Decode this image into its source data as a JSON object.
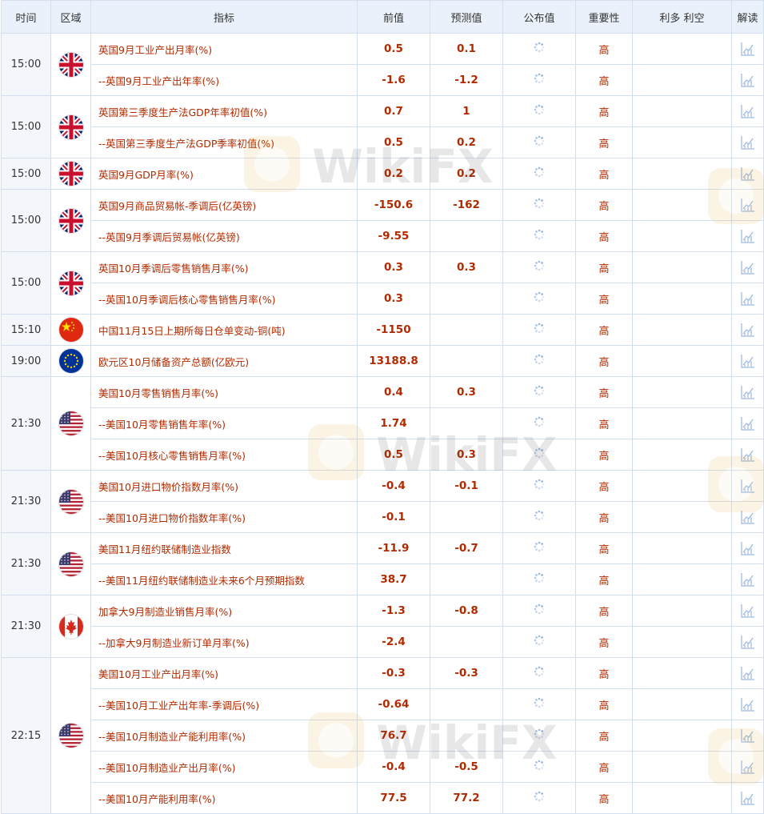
{
  "headers": [
    "时间",
    "区域",
    "指标",
    "前值",
    "预测值",
    "公布值",
    "重要性",
    "利多 利空",
    "解读"
  ],
  "groups": [
    {
      "time": "15:00",
      "flag": "uk-flag-icon",
      "rows": [
        {
          "name": "英国9月工业产出月率(%)",
          "prev": "0.5",
          "forecast": "0.1",
          "importance": "高"
        },
        {
          "name": "--英国9月工业产出年率(%)",
          "prev": "-1.6",
          "forecast": "-1.2",
          "importance": "高"
        }
      ]
    },
    {
      "time": "15:00",
      "flag": "uk-flag-icon",
      "rows": [
        {
          "name": "英国第三季度生产法GDP年率初值(%)",
          "prev": "0.7",
          "forecast": "1",
          "importance": "高"
        },
        {
          "name": "--英国第三季度生产法GDP季率初值(%)",
          "prev": "0.5",
          "forecast": "0.2",
          "importance": "高"
        }
      ]
    },
    {
      "time": "15:00",
      "flag": "uk-flag-icon",
      "rows": [
        {
          "name": "英国9月GDP月率(%)",
          "prev": "0.2",
          "forecast": "0.2",
          "importance": "高"
        }
      ]
    },
    {
      "time": "15:00",
      "flag": "uk-flag-icon",
      "rows": [
        {
          "name": "英国9月商品贸易帐-季调后(亿英镑)",
          "prev": "-150.6",
          "forecast": "-162",
          "importance": "高"
        },
        {
          "name": "--英国9月季调后贸易帐(亿英镑)",
          "prev": "-9.55",
          "forecast": "",
          "importance": "高"
        }
      ]
    },
    {
      "time": "15:00",
      "flag": "uk-flag-icon",
      "rows": [
        {
          "name": "英国10月季调后零售销售月率(%)",
          "prev": "0.3",
          "forecast": "0.3",
          "importance": "高"
        },
        {
          "name": "--英国10月季调后核心零售销售月率(%)",
          "prev": "0.3",
          "forecast": "",
          "importance": "高"
        }
      ]
    },
    {
      "time": "15:10",
      "flag": "cn-flag-icon",
      "rows": [
        {
          "name": "中国11月15日上期所每日仓单变动-铜(吨)",
          "prev": "-1150",
          "forecast": "",
          "importance": "高"
        }
      ]
    },
    {
      "time": "19:00",
      "flag": "eu-flag-icon",
      "rows": [
        {
          "name": "欧元区10月储备资产总额(亿欧元)",
          "prev": "13188.8",
          "forecast": "",
          "importance": "高"
        }
      ]
    },
    {
      "time": "21:30",
      "flag": "us-flag-icon",
      "rows": [
        {
          "name": "美国10月零售销售月率(%)",
          "prev": "0.4",
          "forecast": "0.3",
          "importance": "高"
        },
        {
          "name": "--美国10月零售销售年率(%)",
          "prev": "1.74",
          "forecast": "",
          "importance": "高"
        },
        {
          "name": "--美国10月核心零售销售月率(%)",
          "prev": "0.5",
          "forecast": "0.3",
          "importance": "高"
        }
      ]
    },
    {
      "time": "21:30",
      "flag": "us-flag-icon",
      "rows": [
        {
          "name": "美国10月进口物价指数月率(%)",
          "prev": "-0.4",
          "forecast": "-0.1",
          "importance": "高"
        },
        {
          "name": "--美国10月进口物价指数年率(%)",
          "prev": "-0.1",
          "forecast": "",
          "importance": "高"
        }
      ]
    },
    {
      "time": "21:30",
      "flag": "us-flag-icon",
      "rows": [
        {
          "name": "美国11月纽约联储制造业指数",
          "prev": "-11.9",
          "forecast": "-0.7",
          "importance": "高"
        },
        {
          "name": "--美国11月纽约联储制造业未来6个月预期指数",
          "prev": "38.7",
          "forecast": "",
          "importance": "高"
        }
      ]
    },
    {
      "time": "21:30",
      "flag": "ca-flag-icon",
      "rows": [
        {
          "name": "加拿大9月制造业销售月率(%)",
          "prev": "-1.3",
          "forecast": "-0.8",
          "importance": "高"
        },
        {
          "name": "--加拿大9月制造业新订单月率(%)",
          "prev": "-2.4",
          "forecast": "",
          "importance": "高"
        }
      ]
    },
    {
      "time": "22:15",
      "flag": "us-flag-icon",
      "rows": [
        {
          "name": "美国10月工业产出月率(%)",
          "prev": "-0.3",
          "forecast": "-0.3",
          "importance": "高"
        },
        {
          "name": "--美国10月工业产出年率-季调后(%)",
          "prev": "-0.64",
          "forecast": "",
          "importance": "高"
        },
        {
          "name": "--美国10月制造业产能利用率(%)",
          "prev": "76.7",
          "forecast": "",
          "importance": "高"
        },
        {
          "name": "--美国10月制造业产出月率(%)",
          "prev": "-0.4",
          "forecast": "-0.5",
          "importance": "高"
        },
        {
          "name": "--美国10月产能利用率(%)",
          "prev": "77.5",
          "forecast": "77.2",
          "importance": "高"
        }
      ]
    }
  ],
  "watermark": "WikiFX",
  "colors": {
    "header_bg": "#eaf1fb",
    "border": "#d3dfee",
    "value_red": "#b22a00",
    "time_bg": "#f3f6fa"
  }
}
